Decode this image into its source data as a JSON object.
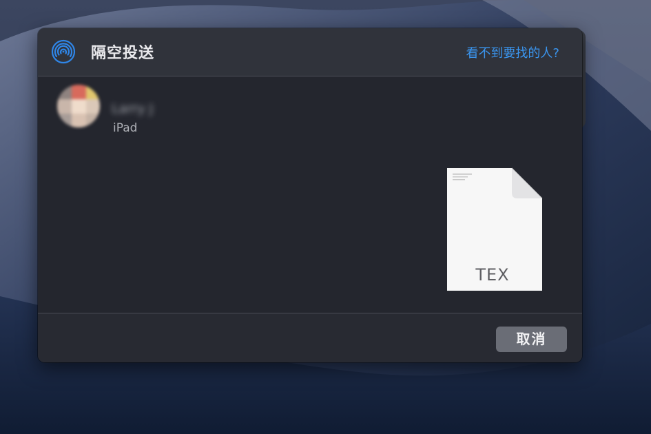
{
  "colors": {
    "accent": "#3a96f0",
    "sheet_background": "#282a32",
    "header_background": "#30333b",
    "button_background": "#6a6d76"
  },
  "airdrop": {
    "icon": "airdrop-icon",
    "title": "隔空投送",
    "help_link": "看不到要找的人?"
  },
  "devices": [
    {
      "name": "Larry J",
      "type": "iPad",
      "avatar_icon": "avatar-icon"
    }
  ],
  "file": {
    "icon": "document-icon",
    "extension": "TEX"
  },
  "footer": {
    "cancel_label": "取消"
  }
}
